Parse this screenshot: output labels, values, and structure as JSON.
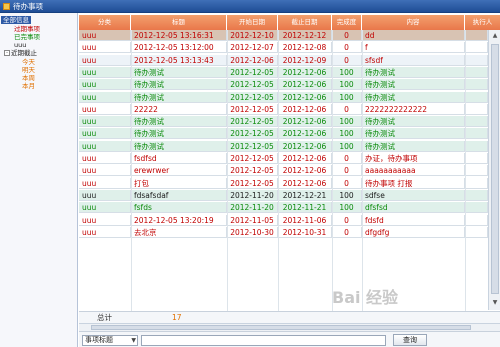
{
  "window": {
    "title": "待办事项"
  },
  "tree": {
    "items": [
      {
        "label": "全部信息",
        "style": "sel"
      },
      {
        "label": "过期事项",
        "style": "red"
      },
      {
        "label": "已完事项",
        "style": "green"
      },
      {
        "label": "uuu",
        "style": "dark"
      },
      {
        "label": "近期截止",
        "style": "dark",
        "toggle": "-"
      },
      {
        "label": "今天",
        "style": "orange"
      },
      {
        "label": "明天",
        "style": "orange"
      },
      {
        "label": "本周",
        "style": "orange"
      },
      {
        "label": "本月",
        "style": "orange"
      }
    ]
  },
  "grid": {
    "columns": [
      "分类",
      "标题",
      "开始日期",
      "截止日期",
      "完成度",
      "内容",
      "执行人"
    ],
    "rows": [
      {
        "tone": "sel",
        "color": "red",
        "cells": [
          "uuu",
          "2012-12-05 13:16:31",
          "2012-12-10",
          "2012-12-12",
          "0",
          "dd"
        ]
      },
      {
        "tone": "white",
        "color": "red",
        "cells": [
          "uuu",
          "2012-12-05 13:12:00",
          "2012-12-07",
          "2012-12-08",
          "0",
          "f"
        ]
      },
      {
        "tone": "blue",
        "color": "red",
        "cells": [
          "uuu",
          "2012-12-05 13:13:43",
          "2012-12-06",
          "2012-12-09",
          "0",
          "sfsdf"
        ]
      },
      {
        "tone": "green",
        "color": "green",
        "cells": [
          "uuu",
          "待办测试",
          "2012-12-05",
          "2012-12-06",
          "100",
          "待办测试"
        ]
      },
      {
        "tone": "green",
        "color": "green",
        "cells": [
          "uuu",
          "待办测试",
          "2012-12-05",
          "2012-12-06",
          "100",
          "待办测试"
        ]
      },
      {
        "tone": "green",
        "color": "green",
        "cells": [
          "uuu",
          "待办测试",
          "2012-12-05",
          "2012-12-06",
          "100",
          "待办测试"
        ]
      },
      {
        "tone": "white",
        "color": "red",
        "cells": [
          "uuu",
          "22222",
          "2012-12-05",
          "2012-12-06",
          "0",
          "2222222222222"
        ]
      },
      {
        "tone": "green",
        "color": "green",
        "cells": [
          "uuu",
          "待办测试",
          "2012-12-05",
          "2012-12-06",
          "100",
          "待办测试"
        ]
      },
      {
        "tone": "green",
        "color": "green",
        "cells": [
          "uuu",
          "待办测试",
          "2012-12-05",
          "2012-12-06",
          "100",
          "待办测试"
        ]
      },
      {
        "tone": "green",
        "color": "green",
        "cells": [
          "uuu",
          "待办测试",
          "2012-12-05",
          "2012-12-06",
          "100",
          "待办测试"
        ]
      },
      {
        "tone": "white",
        "color": "red",
        "cells": [
          "uuu",
          "fsdfsd",
          "2012-12-05",
          "2012-12-06",
          "0",
          "办证，待办事项"
        ]
      },
      {
        "tone": "white",
        "color": "red",
        "cells": [
          "uuu",
          "erewrwer",
          "2012-12-05",
          "2012-12-06",
          "0",
          "aaaaaaaaaaa"
        ]
      },
      {
        "tone": "white",
        "color": "red",
        "cells": [
          "uuu",
          "打包",
          "2012-12-05",
          "2012-12-06",
          "0",
          "待办事项 打报"
        ]
      },
      {
        "tone": "green",
        "color": "dark",
        "cells": [
          "uuu",
          "fdsafsdaf",
          "2012-11-20",
          "2012-12-21",
          "100",
          "sdfse"
        ]
      },
      {
        "tone": "green",
        "color": "green",
        "cells": [
          "uuu",
          "fsfds",
          "2012-11-20",
          "2012-11-21",
          "100",
          "dfsfsd"
        ]
      },
      {
        "tone": "white",
        "color": "red",
        "cells": [
          "uuu",
          "2012-12-05 13:20:19",
          "2012-11-05",
          "2012-11-06",
          "0",
          "fdsfd"
        ]
      },
      {
        "tone": "white",
        "color": "red",
        "cells": [
          "uuu",
          "去北京",
          "2012-10-30",
          "2012-10-31",
          "0",
          "dfgdfg"
        ]
      }
    ]
  },
  "footer": {
    "total_label": "总计",
    "total_count": "17"
  },
  "search": {
    "field_selected": "事项标题",
    "input_value": "",
    "button_label": "查询"
  },
  "watermark": "Bai 经验",
  "colors": {
    "red": "#c00000",
    "green": "#0a8a0a",
    "header": "#e9774a",
    "selected": "#2e5aa5"
  }
}
